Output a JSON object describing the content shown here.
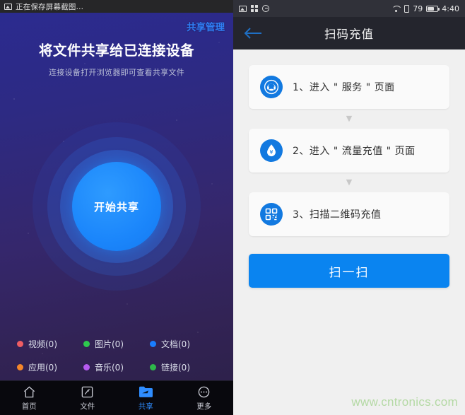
{
  "left_phone": {
    "statusbar": {
      "icon": "photo-icon",
      "text": "正在保存屏幕截图..."
    },
    "share_management_link": "共享管理",
    "title": "将文件共享给已连接设备",
    "subtitle": "连接设备打开浏览器即可查看共享文件",
    "start_button_label": "开始共享",
    "accent_color": "#1b86fb",
    "legend": [
      {
        "label": "视频(0)",
        "color": "#ef5d63"
      },
      {
        "label": "图片(0)",
        "color": "#2ec94e"
      },
      {
        "label": "文档(0)",
        "color": "#1a7dff"
      },
      {
        "label": "应用(0)",
        "color": "#f5862a"
      },
      {
        "label": "音乐(0)",
        "color": "#b55af0"
      },
      {
        "label": "链接(0)",
        "color": "#2eb84a"
      }
    ],
    "tabs": [
      {
        "label": "首页",
        "icon": "home-icon",
        "active": false
      },
      {
        "label": "文件",
        "icon": "file-icon",
        "active": false
      },
      {
        "label": "共享",
        "icon": "folder-share-icon",
        "active": true
      },
      {
        "label": "更多",
        "icon": "more-dots-icon",
        "active": false
      }
    ]
  },
  "right_phone": {
    "statusbar": {
      "left_icons": [
        "photo-icon",
        "grid-icon",
        "clock-icon"
      ],
      "wifi_icon": "wifi-icon",
      "sim_icon": "sim-card-icon",
      "battery_percent": "79",
      "battery_icon": "battery-icon",
      "time": "4:40"
    },
    "back_icon": "back-arrow-icon",
    "title": "扫码充值",
    "steps": [
      {
        "icon": "customer-service-icon",
        "label": "1、进入 \" 服务 \" 页面"
      },
      {
        "icon": "water-drop-yuan-icon",
        "label": "2、进入 \" 流量充值 \" 页面"
      },
      {
        "icon": "qr-code-icon",
        "label": "3、扫描二维码充值"
      }
    ],
    "arrow_glyph": "▼",
    "scan_button_label": "扫一扫",
    "accent_color": "#0a84f0"
  },
  "watermark": "www.cntronics.com"
}
